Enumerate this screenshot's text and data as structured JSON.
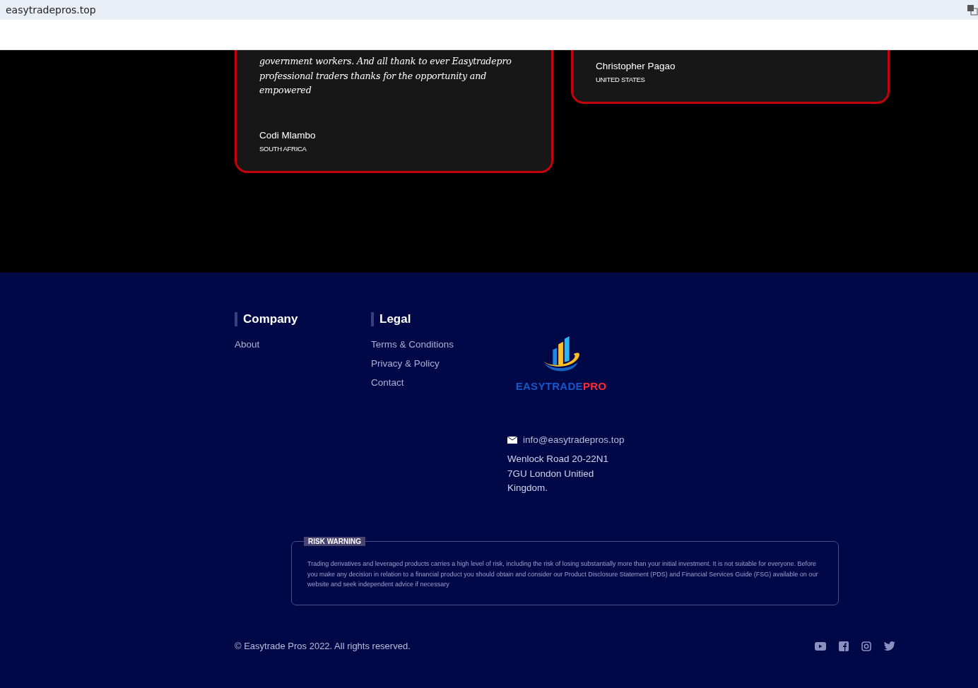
{
  "browser": {
    "address": "easytradepros.top"
  },
  "testimonials": [
    {
      "quote": "government workers. And all thank to ever Easytradepro professional traders thanks for the opportunity and empowered",
      "name": "Codi Mlambo",
      "country": "SOUTH AFRICA"
    },
    {
      "name": "Christopher Pagao",
      "country": "UNITED STATES"
    }
  ],
  "footer": {
    "columns": [
      {
        "heading": "Company",
        "links": [
          "About"
        ]
      },
      {
        "heading": "Legal",
        "links": [
          "Terms & Conditions",
          "Privacy & Policy",
          "Contact"
        ]
      }
    ],
    "logo": {
      "word": "EASYTRADE",
      "accent": "PRO"
    },
    "email": "info@easytradepros.top",
    "address": [
      "Wenlock Road 20-22N1",
      "7GU London Unitied",
      "Kingdom."
    ],
    "risk_warning": {
      "title": "RISK WARNING",
      "text": "Trading derivatives and leveraged products carries a high level of risk, including the risk of losing substantially more than your initial investment. It is not suitable for everyone. Before you make any decision in relation to a financial product you should obtain and consider our Product Disclosure Statement (PDS) and Financial Services Guide (FSG) available on our website and seek independent advice if necessary"
    },
    "copyright": "© Easytrade Pros 2022. All rights reserved.",
    "social": [
      {
        "kind": "youtube"
      },
      {
        "kind": "facebook"
      },
      {
        "kind": "instagram"
      },
      {
        "kind": "twitter"
      }
    ]
  }
}
